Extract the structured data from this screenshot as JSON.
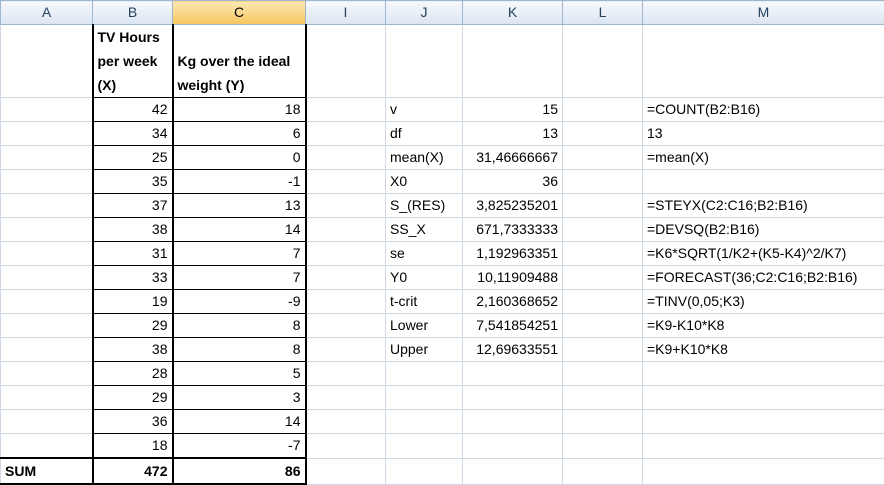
{
  "columns": [
    "A",
    "B",
    "C",
    "I",
    "J",
    "K",
    "L",
    "M"
  ],
  "selected_column": "C",
  "header_row": {
    "B": "TV Hours per week (X)",
    "C": "Kg over the ideal weight (Y)"
  },
  "data_rows": [
    {
      "B": "42",
      "C": "18",
      "J": "v",
      "K": "15",
      "M": "=COUNT(B2:B16)"
    },
    {
      "B": "34",
      "C": "6",
      "J": "df",
      "K": "13",
      "M": "13"
    },
    {
      "B": "25",
      "C": "0",
      "J": "mean(X)",
      "K": "31,46666667",
      "M": "=mean(X)"
    },
    {
      "B": "35",
      "C": "-1",
      "J": "X0",
      "K": "36",
      "M": ""
    },
    {
      "B": "37",
      "C": "13",
      "J": "S_(RES)",
      "K": "3,825235201",
      "M": "=STEYX(C2:C16;B2:B16)"
    },
    {
      "B": "38",
      "C": "14",
      "J": "SS_X",
      "K": "671,7333333",
      "M": "=DEVSQ(B2:B16)"
    },
    {
      "B": "31",
      "C": "7",
      "J": "se",
      "K": "1,192963351",
      "M": "=K6*SQRT(1/K2+(K5-K4)^2/K7)"
    },
    {
      "B": "33",
      "C": "7",
      "J": "Y0",
      "K": "10,11909488",
      "M": "=FORECAST(36;C2:C16;B2:B16)"
    },
    {
      "B": "19",
      "C": "-9",
      "J": "t-crit",
      "K": "2,160368652",
      "M": "=TINV(0,05;K3)"
    },
    {
      "B": "29",
      "C": "8",
      "J": "Lower",
      "K": "7,541854251",
      "M": "=K9-K10*K8"
    },
    {
      "B": "38",
      "C": "8",
      "J": "Upper",
      "K": "12,69633551",
      "M": "=K9+K10*K8"
    },
    {
      "B": "28",
      "C": "5"
    },
    {
      "B": "29",
      "C": "3"
    },
    {
      "B": "36",
      "C": "14"
    },
    {
      "B": "18",
      "C": "-7"
    }
  ],
  "sum_row": {
    "A": "SUM",
    "B": "472",
    "C": "86"
  }
}
